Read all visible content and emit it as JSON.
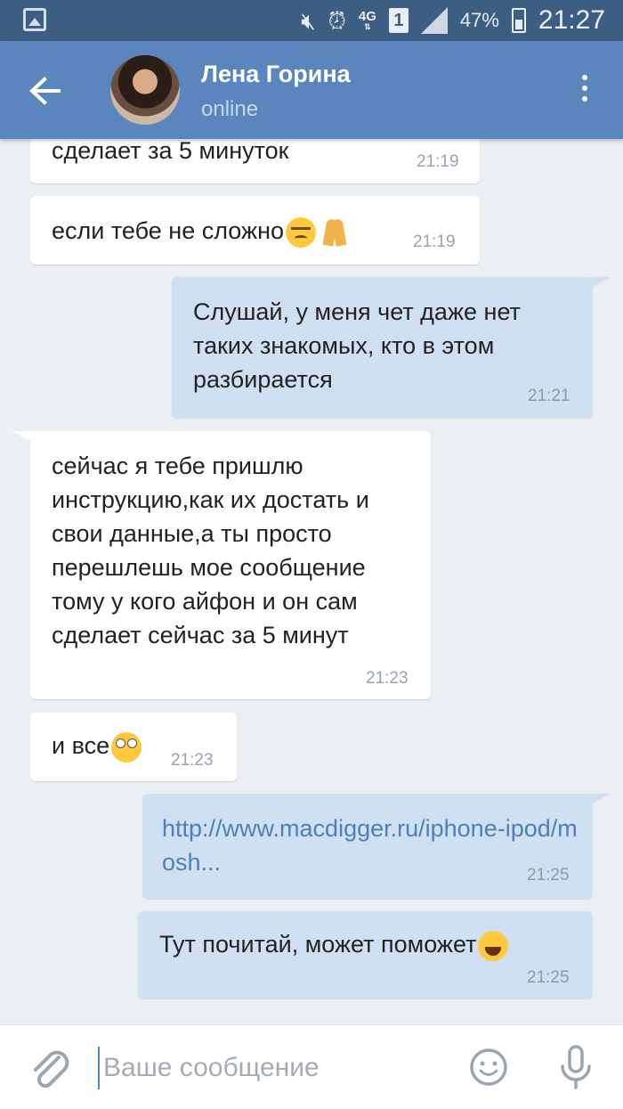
{
  "status_bar": {
    "battery_percent": "47%",
    "clock": "21:27",
    "network": "4G",
    "sim_slot": "1"
  },
  "header": {
    "contact_name": "Лена Горина",
    "contact_status": "online"
  },
  "messages": [
    {
      "direction": "in",
      "text": "сделает за 5 минуток",
      "time": "21:19"
    },
    {
      "direction": "in",
      "text": "если тебе не сложно",
      "emoji": [
        "unamused-face",
        "folded-hands"
      ],
      "time": "21:19"
    },
    {
      "direction": "out",
      "text": "Слушай,  у меня чет даже нет таких знакомых,  кто в этом разбирается",
      "time": "21:21"
    },
    {
      "direction": "in",
      "text": "сейчас я тебе пришлю инструкцию,как их достать и свои данные,а ты просто перешлешь мое сообщение тому у кого айфон и он сам сделает сейчас за 5 минут",
      "time": "21:23"
    },
    {
      "direction": "in",
      "text": "и все",
      "emoji": [
        "rolling-eyes-face"
      ],
      "time": "21:23"
    },
    {
      "direction": "out",
      "text": "http://www.macdigger.ru/iphone-ipod/mosh...",
      "is_link": true,
      "time": "21:25"
    },
    {
      "direction": "out",
      "text": "Тут почитай, может поможет",
      "emoji": [
        "rofl-face"
      ],
      "time": "21:25"
    }
  ],
  "input": {
    "placeholder": "Ваше сообщение"
  },
  "colors": {
    "status_bar": "#3d5e83",
    "header": "#5b86bd",
    "background": "#ebeef2",
    "incoming_bubble": "#ffffff",
    "outgoing_bubble": "#cfe0f3",
    "link": "#4f7fb7"
  }
}
